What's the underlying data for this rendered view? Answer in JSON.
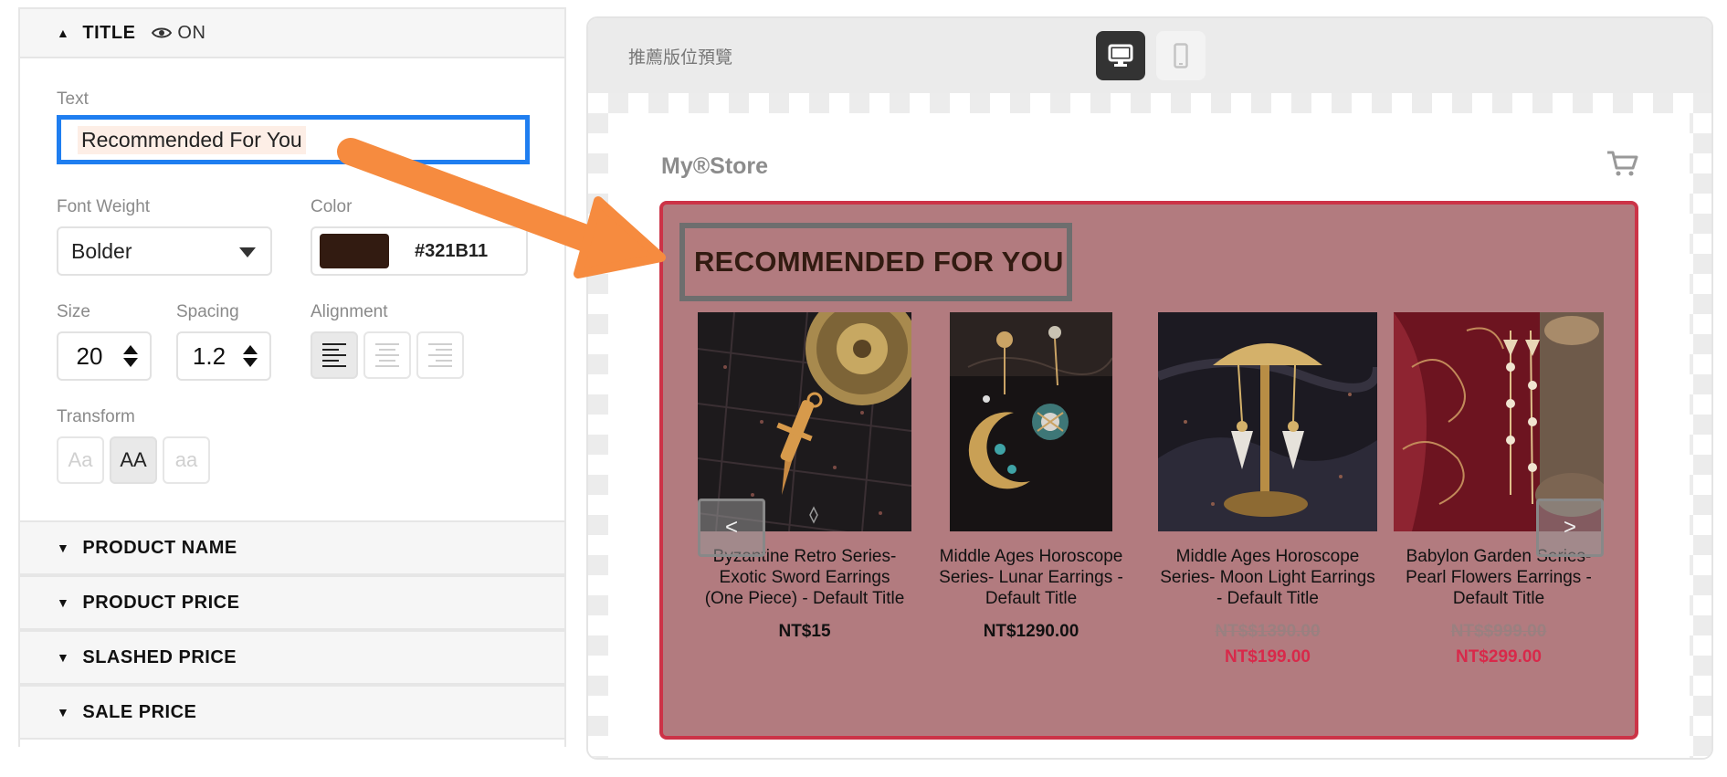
{
  "panel": {
    "title_section": {
      "label": "TITLE",
      "visibility": "ON"
    },
    "text_label": "Text",
    "text_value": "Recommended For You",
    "font_weight_label": "Font Weight",
    "font_weight_value": "Bolder",
    "color_label": "Color",
    "color_hex": "#321B11",
    "size_label": "Size",
    "size_value": "20",
    "spacing_label": "Spacing",
    "spacing_value": "1.2",
    "alignment_label": "Alignment",
    "alignment_selected": "left",
    "transform_label": "Transform",
    "transform_options": [
      "Aa",
      "AA",
      "aa"
    ],
    "transform_selected": "AA",
    "collapsed_sections": [
      "PRODUCT NAME",
      "PRODUCT PRICE",
      "SLASHED PRICE",
      "SALE PRICE"
    ]
  },
  "preview": {
    "title": "推薦版位預覽",
    "device_selected": "desktop",
    "store_name": "My®Store",
    "heading": "RECOMMENDED FOR YOU",
    "products": [
      {
        "name": "Byzantine Retro Series-Exotic Sword Earrings (One Piece) - Default Title",
        "price": "NT$15",
        "slashed": "",
        "sale": ""
      },
      {
        "name": "Middle Ages Horoscope Series- Lunar Earrings - Default Title",
        "price": "NT$1290.00",
        "slashed": "",
        "sale": ""
      },
      {
        "name": "Middle Ages Horoscope Series- Moon Light Earrings - Default Title",
        "price": "",
        "slashed": "NT$$1390.00",
        "sale": "NT$199.00"
      },
      {
        "name": "Babylon Garden Series-Pearl Flowers Earrings - Default Title",
        "price": "",
        "slashed": "NT$$999.00",
        "sale": "NT$299.00"
      }
    ],
    "prev_arrow": "<",
    "next_arrow": ">"
  },
  "colors": {
    "accent_blue": "#1F7EF0",
    "title_color": "#321B11",
    "block_bg": "#B27B7F",
    "block_border": "#CC3347",
    "sale_red": "#D8294A",
    "arrow_orange": "#F68B3F"
  },
  "icons": [
    "caret-up-icon",
    "eye-icon",
    "caret-down-icon",
    "desktop-icon",
    "mobile-icon",
    "cart-icon",
    "align-left-icon",
    "align-center-icon",
    "align-right-icon"
  ]
}
